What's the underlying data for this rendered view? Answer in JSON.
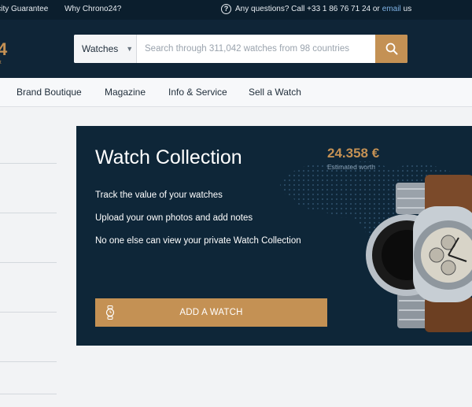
{
  "topbar": {
    "left_items": [
      "icity Guarantee",
      "Why Chrono24?"
    ],
    "question_text": "Any questions? Call +33 1 86 76 71 24 or",
    "email_text": "email",
    "us_text": "us"
  },
  "header": {
    "logo_fragment": "4",
    "logo_sub_fragment": "t",
    "category_value": "Watches",
    "search_placeholder": "Search through 311,042 watches from 98 countries"
  },
  "nav": {
    "items": [
      "Brand Boutique",
      "Magazine",
      "Info & Service",
      "Sell a Watch"
    ]
  },
  "collection": {
    "title": "Watch Collection",
    "price": "24.358 €",
    "price_label": "Estimated worth",
    "features": [
      "Track the value of your watches",
      "Upload your own photos and add notes",
      "No one else can view your private Watch Collection"
    ],
    "add_button": "ADD A WATCH"
  },
  "colors": {
    "accent": "#c49154",
    "topbar_bg": "#0b1e2d",
    "header_bg": "#0f2537",
    "card_bg": "#0e2638",
    "link": "#7fb2e5"
  },
  "icons": [
    "question-circle-icon",
    "chevron-down-icon",
    "search-icon",
    "watch-icon"
  ]
}
